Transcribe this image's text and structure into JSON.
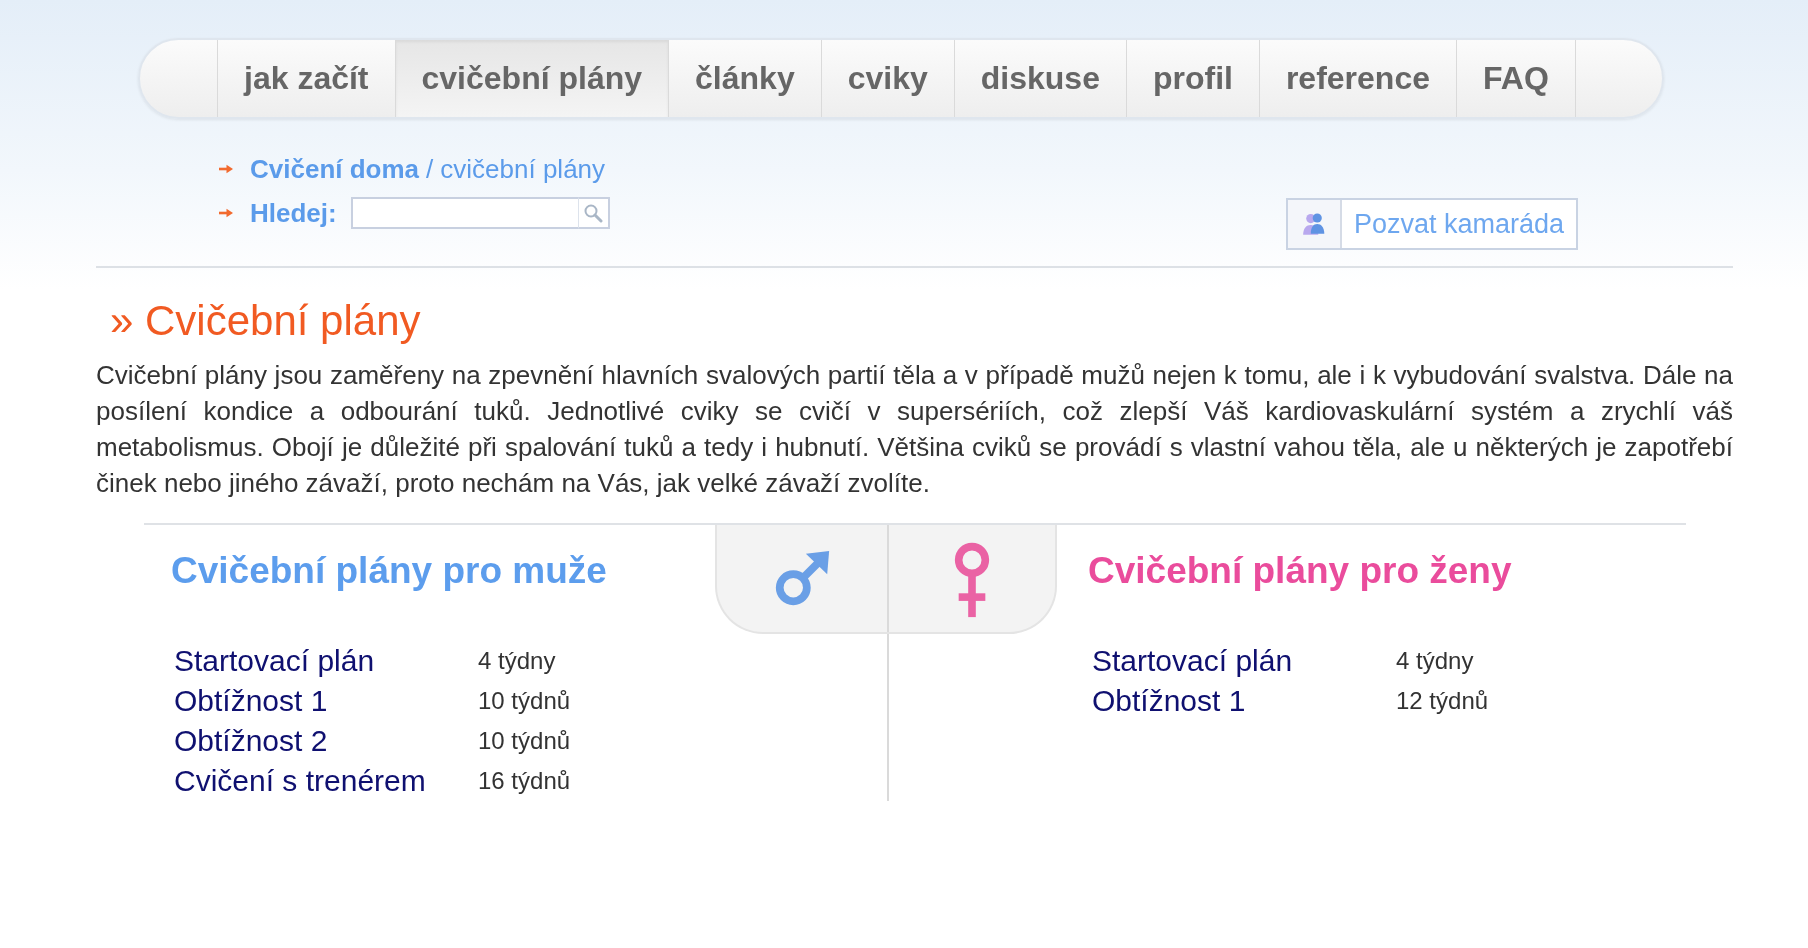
{
  "nav": {
    "tabs": [
      {
        "label": "jak začít",
        "selected": false
      },
      {
        "label": "cvičební plány",
        "selected": true
      },
      {
        "label": "články",
        "selected": false
      },
      {
        "label": "cviky",
        "selected": false
      },
      {
        "label": "diskuse",
        "selected": false
      },
      {
        "label": "profil",
        "selected": false
      },
      {
        "label": "reference",
        "selected": false
      },
      {
        "label": "FAQ",
        "selected": false
      }
    ]
  },
  "breadcrumb": {
    "items": [
      {
        "label": "Cvičení doma",
        "kind": "link"
      },
      {
        "label": "cvičební plány",
        "kind": "current"
      }
    ],
    "separator": "/"
  },
  "search": {
    "label": "Hledej:"
  },
  "invite_button": {
    "label": "Pozvat kamaráda"
  },
  "page_title": "» Cvičební plány",
  "intro": "Cvičební plány jsou zaměřeny na zpevnění hlavních svalových partií těla a v případě mužů nejen k tomu, ale i k vybudování svalstva. Dále na posílení kondice a odbourání tuků. Jednotlivé cviky se cvičí v supersériích, což zlepší Váš kardiovaskulární systém a zrychlí váš metabolismus. Obojí je důležité při spalování tuků a tedy i hubnutí. Většina cviků se provádí s vlastní vahou těla, ale u některých je zapotřebí činek nebo jiného závaží, proto nechám na Vás, jak velké závaží zvolíte.",
  "plans": [
    {
      "heading": "Cvičební plány pro muže",
      "kind": "male",
      "color": "#5c9ded",
      "items": [
        {
          "name": "Startovací plán",
          "duration": "4 týdny"
        },
        {
          "name": "Obtížnost 1",
          "duration": "10 týdnů"
        },
        {
          "name": "Obtížnost 2",
          "duration": "10 týdnů"
        },
        {
          "name": "Cvičení s trenérem",
          "duration": "16 týdnů"
        }
      ]
    },
    {
      "heading": "Cvičební plány pro ženy",
      "kind": "female",
      "color": "#ea4c9c",
      "items": [
        {
          "name": "Startovací plán",
          "duration": "4 týdny"
        },
        {
          "name": "Obtížnost 1",
          "duration": "12 týdnů"
        }
      ]
    }
  ]
}
